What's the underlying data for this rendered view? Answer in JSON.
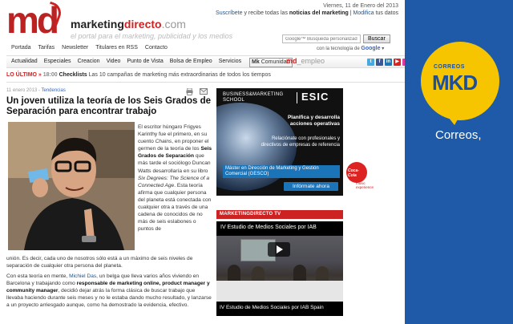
{
  "header": {
    "logo_md": "md",
    "logo_marketing": "marketing",
    "logo_directo": "directo",
    "logo_com": ".com",
    "tagline": "el portal para el marketing, publicidad y los medios",
    "date": "Viernes, 11 de Enero del 2013",
    "subscribe_link": "Suscríbete",
    "subscribe_text": "y recibe todas las",
    "subscribe_bold": "noticias del marketing",
    "modify_link": "Modifica",
    "modify_text": "tus datos"
  },
  "topnav": [
    "Portada",
    "Tarifas",
    "Newsletter",
    "Titulares en RSS",
    "Contacto"
  ],
  "search": {
    "placeholder": "Google™ Búsqueda personalizada",
    "button": "Buscar",
    "tech_text": "con la tecnología de",
    "tech_brand": "Google"
  },
  "mainnav": [
    "Actualidad",
    "Especiales",
    "Creacion",
    "Video",
    "Punto de Vista",
    "Bolsa de Empleo",
    "Servicios"
  ],
  "comunidad": "Comunidad",
  "mdempleo_md": "md",
  "mdempleo_rest": "_empleo",
  "social": [
    {
      "name": "twitter-icon",
      "glyph": "t",
      "color": "#4aa8e0"
    },
    {
      "name": "facebook-icon",
      "glyph": "f",
      "color": "#3b5998"
    },
    {
      "name": "linkedin-icon",
      "glyph": "in",
      "color": "#1f78b4"
    },
    {
      "name": "youtube-icon",
      "glyph": "▶",
      "color": "#d22"
    },
    {
      "name": "flickr-icon",
      "glyph": "•",
      "color": "#e23ba0"
    },
    {
      "name": "rss-icon",
      "glyph": "≋",
      "color": "#f08a1e"
    },
    {
      "name": "google-plus-icon",
      "glyph": "g",
      "color": "#d44"
    }
  ],
  "ticker": {
    "label": "LO ÚLTIMO »",
    "time": "18:00",
    "bold": "Checklists",
    "text": "Las 10 campañas de marketing más extraordinarias de todos los tiempos"
  },
  "article": {
    "date": "11 enero 2013",
    "separator": " - ",
    "category": "Tendencias",
    "headline": "Un joven utiliza la teoría de los Seis Grados de Separación para encontrar trabajo",
    "col_p1": "El escritor húngaro Frigyes Karinthy fue el primero, en su cuento",
    "col_p1_italic": "Chains",
    "col_p2": ", en proponer el germen de la teoría de los",
    "col_p2_bold": "Seis Grados de Separación",
    "col_p3": "que más tarde el sociólogo Duncan Watts desarrollaría en su libro",
    "col_p3_italic": "Six Degrees: The Science of a Connected Age",
    "col_p4": ". Esta teoría afirma que cualquier persona del planeta está conectada con cualquier otra a través de una cadena de conocidos de no más de seis eslabones o puntos de",
    "full_p1": "unión. Es decir, cada uno de nosotros sólo está a un máximo de seis niveles de separación de cualquier otra persona del planeta.",
    "full_p2a": "Con esta teoría en mente,",
    "full_p2_link": "Michiel Das",
    "full_p2b": ", un belga que lleva varios años viviendo en Barcelona y trabajando como",
    "full_p2_bold": "responsable de marketing online, product manager y community manager",
    "full_p2c": ", decidió dejar atrás la forma clásica de buscar trabajo que llevaba haciendo durante seis meses y no le estaba dando mucho resultado, y lanzarse a un proyecto arriesgado aunque, como ha demostrado la evidencia, efectivo."
  },
  "esic": {
    "top_line1": "BUSINESS&MARKETING",
    "top_line2": "SCHOOL",
    "logo": "ESIC",
    "h1": "Planifica y desarrolla acciones operativas",
    "h2": "Relaciónate con profesionales y directivos de empresas de referencia",
    "master": "Máster en Dirección de Marketing y Gestión Comercial (GESCO)",
    "button": "Infórmate ahora"
  },
  "coke": {
    "brand": "Coca-Cola",
    "line1": "music",
    "line2": "experience"
  },
  "tv": {
    "bar": "MARKETINGDIRECTO TV",
    "title": "IV Estudio de Medios Sociales por IAB",
    "caption": "IV Estudio de Medios Sociales por IAB Spain"
  },
  "adright": {
    "small": "CORREOS",
    "mkd": "MKD",
    "big": "Correos,"
  },
  "colors": {
    "brand_red": "#cc2222",
    "link_blue": "#225588",
    "ad_blue": "#1e5aa8",
    "ad_yellow": "#f7c500",
    "esic_blue": "#1b73b8"
  }
}
